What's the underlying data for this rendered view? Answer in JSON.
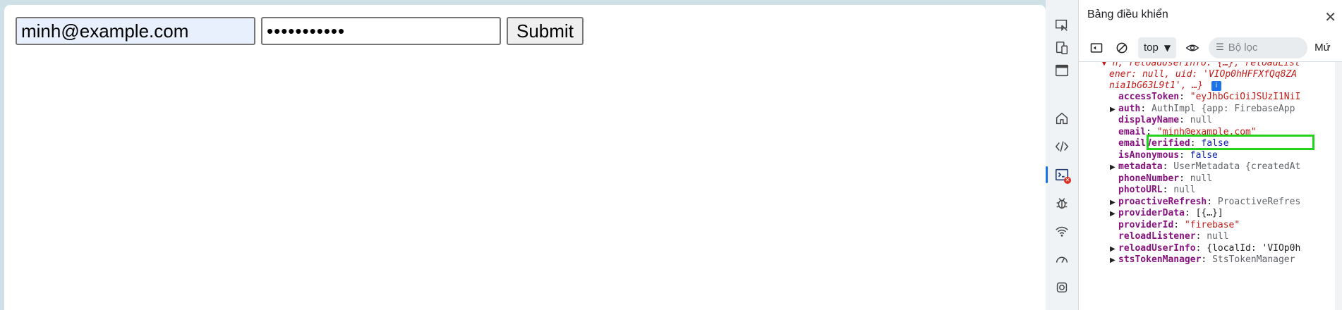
{
  "form": {
    "email_value": "minh@example.com",
    "password_value": "•••••••••••",
    "submit_label": "Submit"
  },
  "devtools": {
    "title": "Bảng điều khiển",
    "close_glyph": "✕",
    "toolbar": {
      "context": "top",
      "filter_placeholder": "Bộ lọc",
      "more_label": "Mứ"
    },
    "rail_icons": [
      "inspect-icon",
      "device-icon",
      "panel-icon",
      "home-icon",
      "elements-icon",
      "console-icon",
      "bug-icon",
      "network-icon",
      "performance-icon",
      "settings-icon"
    ],
    "console": {
      "header_line1": "▼ n, reloadUserInfo: {…}, reloadList",
      "header_line2": "ener: null, uid: 'VIOp0hHFFXfQq8ZA",
      "header_line3": "nia1bG63L9t1', …}",
      "rows": [
        {
          "key": "accessToken",
          "sep": ": ",
          "value": "\"eyJhbGciOiJSUzI1NiI",
          "vtype": "str",
          "expand": false
        },
        {
          "key": "auth",
          "sep": ": ",
          "value": "AuthImpl {app: FirebaseApp",
          "vtype": "obj",
          "expand": true
        },
        {
          "key": "displayName",
          "sep": ": ",
          "value": "null",
          "vtype": "dim",
          "expand": false
        },
        {
          "key": "email",
          "sep": ": ",
          "value": "\"minh@example.com\"",
          "vtype": "str",
          "expand": false
        },
        {
          "key": "emailVerified",
          "sep": ": ",
          "value": "false",
          "vtype": "kw",
          "expand": false
        },
        {
          "key": "isAnonymous",
          "sep": ": ",
          "value": "false",
          "vtype": "kw",
          "expand": false
        },
        {
          "key": "metadata",
          "sep": ": ",
          "value": "UserMetadata {createdAt",
          "vtype": "obj",
          "expand": true
        },
        {
          "key": "phoneNumber",
          "sep": ": ",
          "value": "null",
          "vtype": "dim",
          "expand": false
        },
        {
          "key": "photoURL",
          "sep": ": ",
          "value": "null",
          "vtype": "dim",
          "expand": false
        },
        {
          "key": "proactiveRefresh",
          "sep": ": ",
          "value": "ProactiveRefres",
          "vtype": "obj",
          "expand": true
        },
        {
          "key": "providerData",
          "sep": ": ",
          "value": "[{…}]",
          "vtype": "plain",
          "expand": true
        },
        {
          "key": "providerId",
          "sep": ": ",
          "value": "\"firebase\"",
          "vtype": "str",
          "expand": false
        },
        {
          "key": "reloadListener",
          "sep": ": ",
          "value": "null",
          "vtype": "dim",
          "expand": false
        },
        {
          "key": "reloadUserInfo",
          "sep": ": ",
          "value": "{localId: 'VIOp0h",
          "vtype": "plain",
          "expand": true
        },
        {
          "key": "stsTokenManager",
          "sep": ": ",
          "value": "StsTokenManager",
          "vtype": "obj",
          "expand": true
        }
      ]
    }
  },
  "colors": {
    "highlight": "#22d31a",
    "accent": "#1a73e8",
    "error": "#d93025"
  }
}
